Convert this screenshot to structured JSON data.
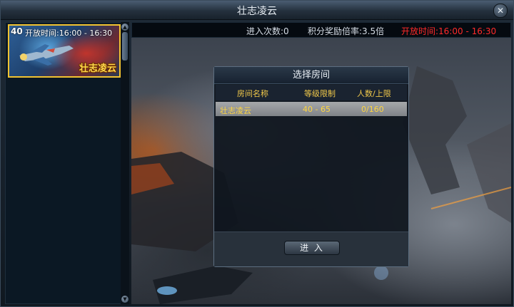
{
  "window": {
    "title": "壮志凌云",
    "close_glyph": "✕"
  },
  "sidebar": {
    "items": [
      {
        "level": "40",
        "time": "开放时间:16:00 - 16:30",
        "name": "壮志凌云",
        "border_color": "#f2c330"
      }
    ]
  },
  "scroll": {
    "up_glyph": "▲",
    "down_glyph": "▼"
  },
  "infobar": {
    "entries": "进入次数:0",
    "multiplier": "积分奖励倍率:3.5倍",
    "open_time": "开放时间:16:00 - 16:30",
    "open_time_color": "#ff2a2a"
  },
  "dialog": {
    "title": "选择房间",
    "columns": [
      "房间名称",
      "等级限制",
      "人数/上限"
    ],
    "rows": [
      {
        "name": "壮志凌云",
        "level": "40 - 65",
        "count": "0/160"
      }
    ],
    "enter_label": "进  入"
  }
}
